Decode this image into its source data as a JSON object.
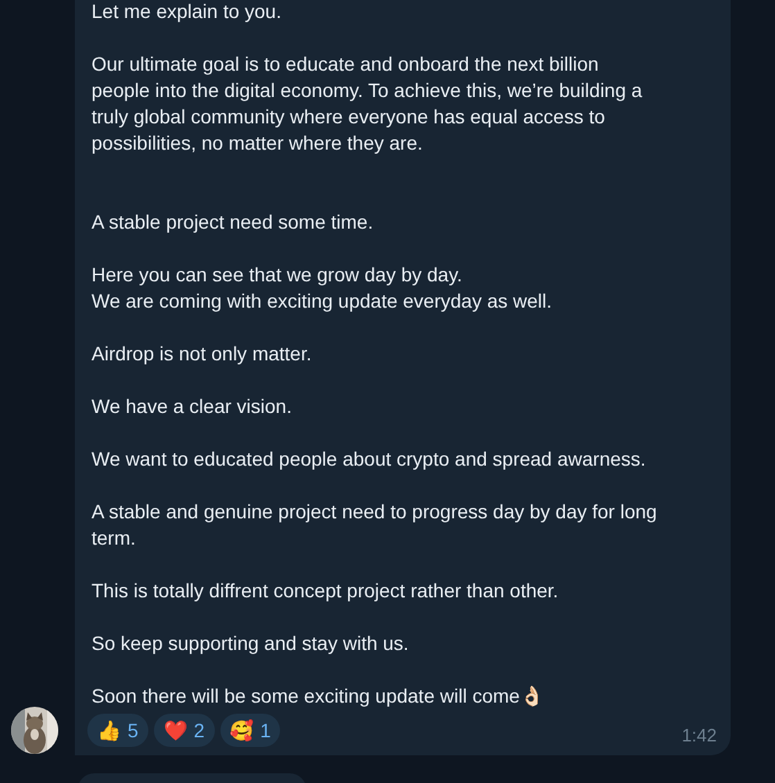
{
  "message": {
    "text": "Let me explain to you.\n\nOur ultimate goal is to educate and onboard the next billion\npeople into the digital economy. To achieve this, we’re building a\ntruly global community where everyone has equal access to\npossibilities, no matter where they are.\n\n\nA stable project need some time.\n\nHere you can see that we grow day by day.\nWe are coming with exciting update everyday as well.\n\nAirdrop is not only matter.\n\nWe have a clear vision.\n\nWe want to educated people about crypto and spread awarness.\n\nA stable and genuine project need to progress day by day for long\nterm.\n\nThis is totally diffrent concept project rather than other.\n\nSo keep supporting and stay with us.\n\nSoon there will be some exciting update will come👌🏻",
    "reactions": [
      {
        "emoji": "👍",
        "count": "5"
      },
      {
        "emoji": "❤️",
        "count": "2"
      },
      {
        "emoji": "🥰",
        "count": "1"
      }
    ],
    "time": "1:42"
  }
}
